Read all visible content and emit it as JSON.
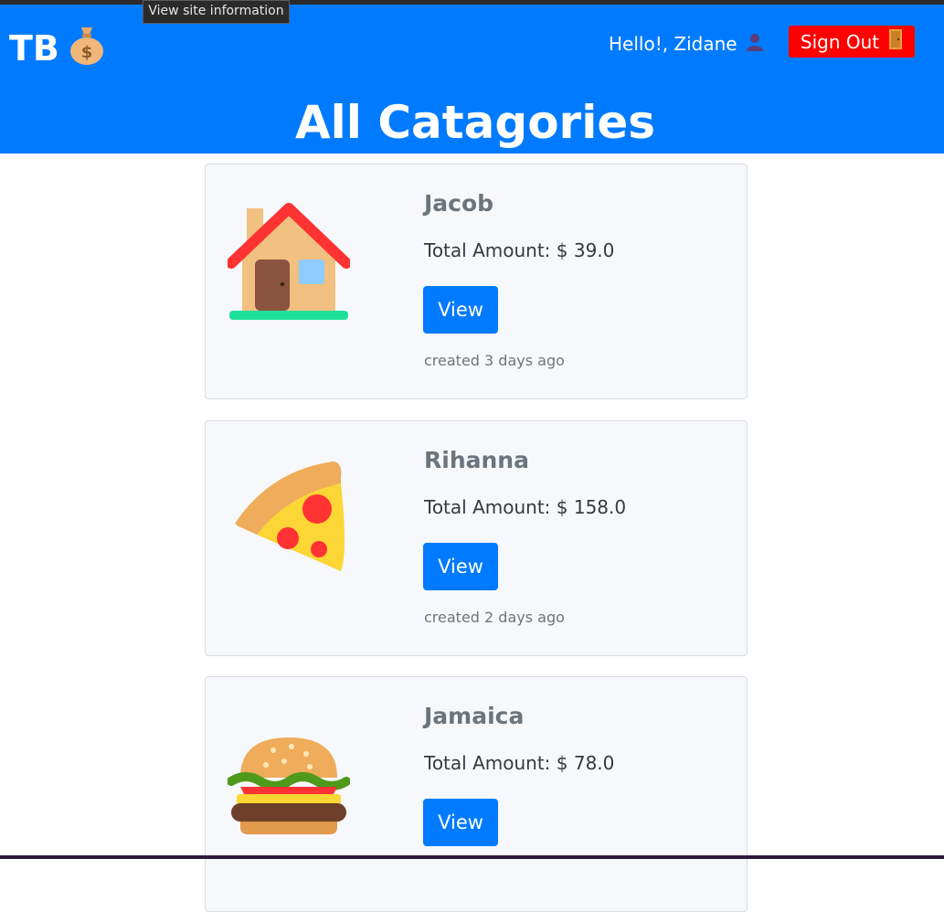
{
  "tooltip": "View site information",
  "brand": {
    "text": "TB",
    "icon": "money-bag-icon"
  },
  "header": {
    "greeting": "Hello!, Zidane",
    "greeting_icon": "user-silhouette-icon",
    "signout_label": "Sign Out",
    "signout_icon": "door-icon",
    "background": "#007bff",
    "signout_color": "#ff0000"
  },
  "page_title": "All Catagories",
  "amount_prefix": "Total Amount: $ ",
  "view_label": "View",
  "categories": [
    {
      "name": "Jacob",
      "amount": "39.0",
      "created": "created 3 days ago",
      "icon": "house-icon"
    },
    {
      "name": "Rihanna",
      "amount": "158.0",
      "created": "created 2 days ago",
      "icon": "pizza-icon"
    },
    {
      "name": "Jamaica",
      "amount": "78.0",
      "created": "",
      "icon": "burger-icon"
    }
  ]
}
